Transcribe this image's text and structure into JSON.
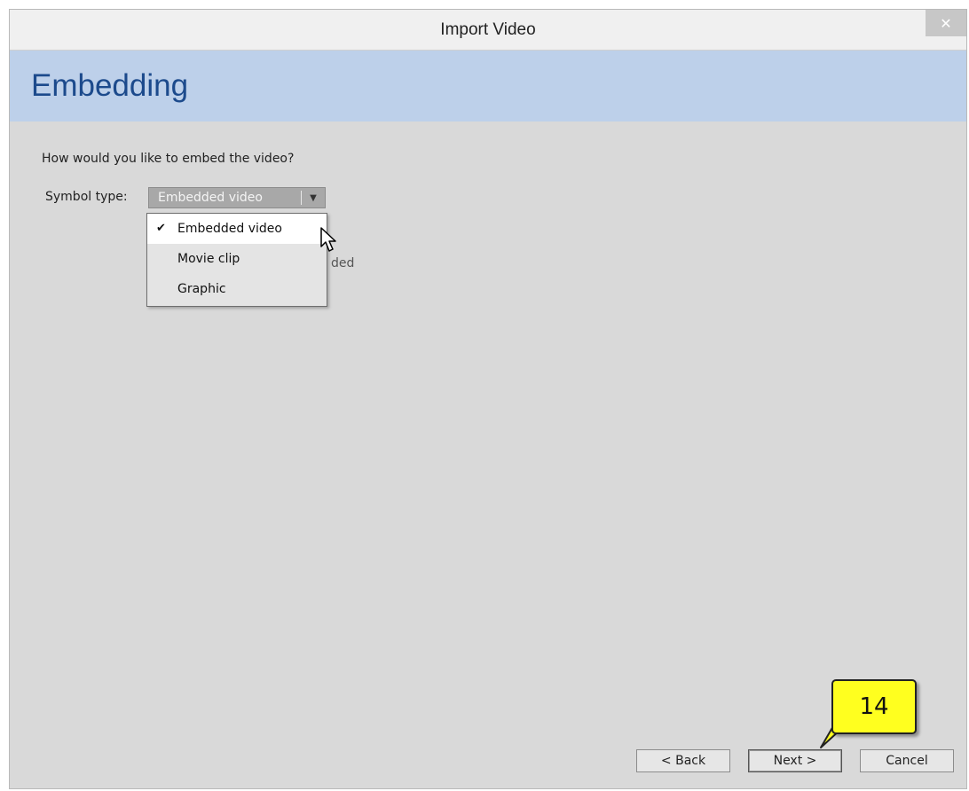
{
  "window": {
    "title": "Import Video",
    "close_glyph": "✕"
  },
  "header": {
    "title": "Embedding"
  },
  "content": {
    "question": "How would you like to embed the video?",
    "symbol_type_label": "Symbol type:",
    "symbol_type_value": "Embedded video",
    "partially_hidden_text": "ded"
  },
  "dropdown_options": [
    {
      "label": "Embedded video",
      "selected": true,
      "check_glyph": "✔"
    },
    {
      "label": "Movie clip",
      "selected": false
    },
    {
      "label": "Graphic",
      "selected": false
    }
  ],
  "footer": {
    "back_label": "< Back",
    "next_label": "Next >",
    "cancel_label": "Cancel"
  },
  "callout": {
    "number": "14"
  },
  "colors": {
    "header_band": "#bdd0ea",
    "header_text": "#1c4a8c",
    "callout_fill": "#ffff1f"
  }
}
